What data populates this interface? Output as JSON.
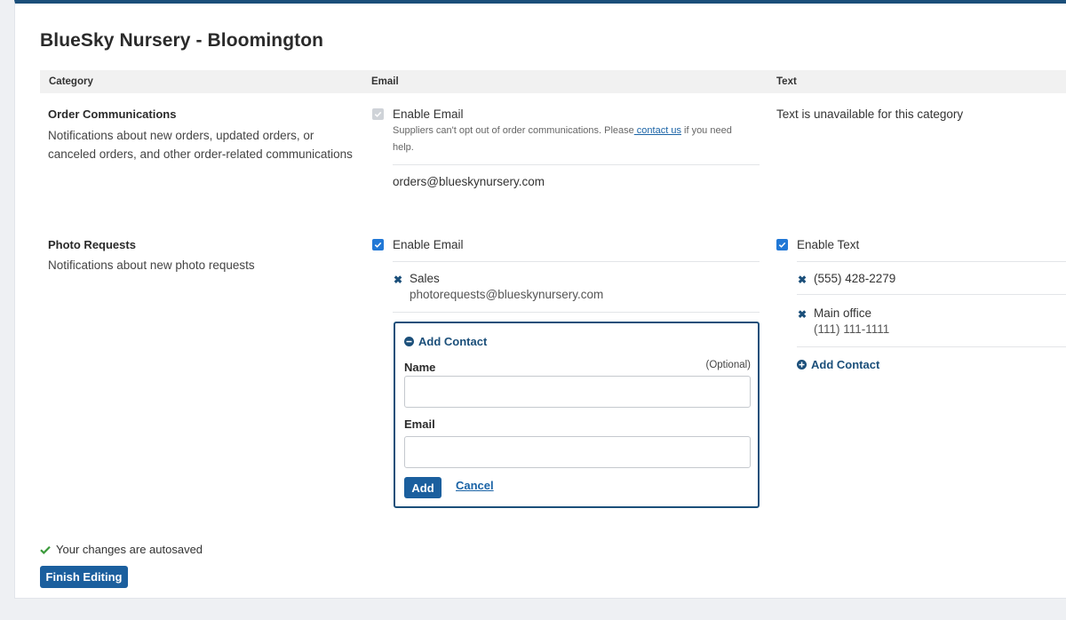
{
  "page": {
    "title": "BlueSky Nursery - Bloomington"
  },
  "table": {
    "headers": {
      "category": "Category",
      "email": "Email",
      "text": "Text"
    }
  },
  "order": {
    "name": "Order Communications",
    "description_line1": "Notifications about new orders, updated orders, or",
    "description_line2": "canceled orders, and other order-related communications",
    "email_label": "Enable Email",
    "note_before": "Suppliers can't opt out of order communications. Please",
    "note_link": " contact us",
    "note_after": " if you need",
    "note_line2": "help.",
    "email_address": "orders@blueskynursery.com",
    "text_unavailable": "Text is unavailable for this category"
  },
  "photo": {
    "name": "Photo Requests",
    "description": "Notifications about new photo requests",
    "email_label": "Enable Email",
    "email_contact": {
      "name": "Sales",
      "value": "photorequests@blueskynursery.com"
    },
    "add_form": {
      "title": "Add Contact",
      "name_label": "Name",
      "optional_label": "(Optional)",
      "email_label": "Email",
      "name_value": "",
      "email_value": "",
      "add_button": "Add",
      "cancel_link": "Cancel"
    },
    "text_label": "Enable Text",
    "text_contacts": [
      {
        "name": "(555) 428-2279",
        "value": ""
      },
      {
        "name": "Main office",
        "value": "(111) 111-1111"
      }
    ],
    "text_add_contact": "Add Contact"
  },
  "footer": {
    "autosave": "Your changes are autosaved",
    "finish_button": "Finish Editing"
  },
  "colors": {
    "accent": "#1b4f7a",
    "checkbox": "#2178d6",
    "success": "#3a9a3a"
  }
}
